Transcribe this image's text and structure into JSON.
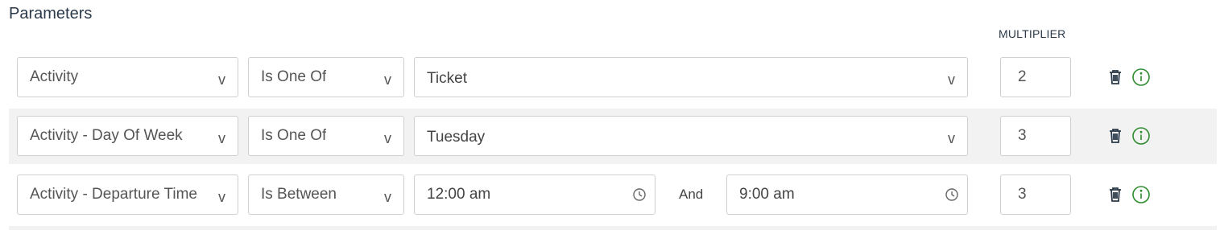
{
  "title": "Parameters",
  "multiplier_header": "MULTIPLIER",
  "rows": [
    {
      "attribute": "Activity",
      "operator": "Is One Of",
      "value": "Ticket",
      "multiplier": "2"
    },
    {
      "attribute": "Activity - Day Of Week",
      "operator": "Is One Of",
      "value": "Tuesday",
      "multiplier": "3"
    },
    {
      "attribute": "Activity - Departure Time",
      "operator": "Is Between",
      "from_time": "12:00 am",
      "between_label": "And",
      "to_time": "9:00 am",
      "multiplier": "3"
    }
  ],
  "dropdown_caret": "v",
  "icons": {
    "delete": "trash-icon",
    "info": "info-icon",
    "time": "clock-icon"
  },
  "colors": {
    "title": "#2b3a4a",
    "trash": "#2b3a4a",
    "info": "#2e8b2e",
    "row_shade": "#f2f2f2",
    "border": "#cfcfcf"
  }
}
